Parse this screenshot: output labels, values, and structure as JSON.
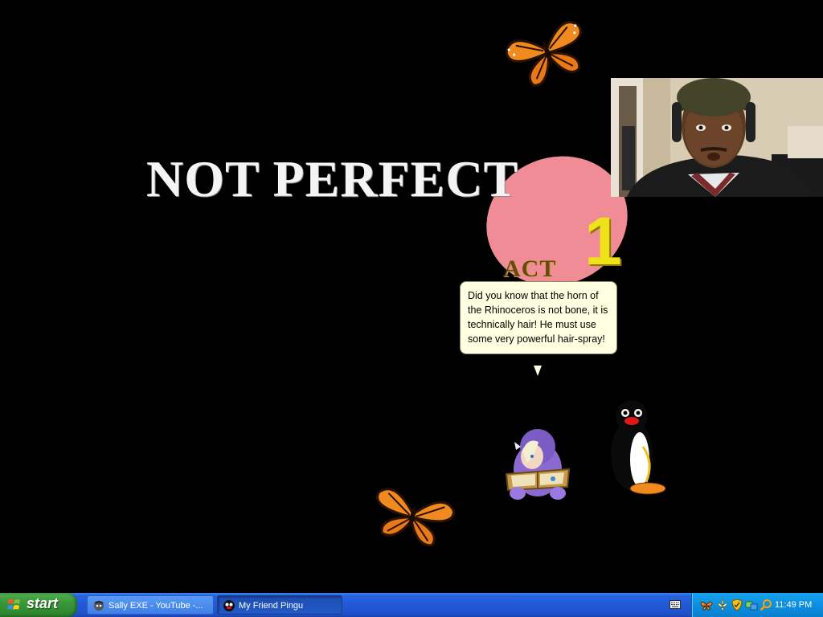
{
  "scene": {
    "title": "NOT PERFECT",
    "act_label": "ACT",
    "act_number": "1"
  },
  "assistant": {
    "speech": "Did you know that the horn of the Rhinoceros is not bone, it is technically hair! He must use some very powerful hair-spray!"
  },
  "taskbar": {
    "start_label": "start",
    "tasks": [
      {
        "label": "Sally EXE - YouTube -...",
        "icon": "youtube-browser-icon",
        "active": false
      },
      {
        "label": "My Friend Pingu",
        "icon": "pingu-app-icon",
        "active": true
      }
    ],
    "tray_icons": [
      "butterfly-tray-icon",
      "fleur-tray-icon",
      "shield-tray-icon",
      "network-tray-icon",
      "search-tray-icon"
    ],
    "clock": "11:49 PM"
  },
  "colors": {
    "desktop_bg": "#000000",
    "blob_pink": "#f08c96",
    "act_yellow": "#f0e21a",
    "bubble_bg": "#ffffe1",
    "taskbar_blue": "#2358d6",
    "start_green": "#3b973b",
    "tray_blue": "#0d8fdf"
  }
}
